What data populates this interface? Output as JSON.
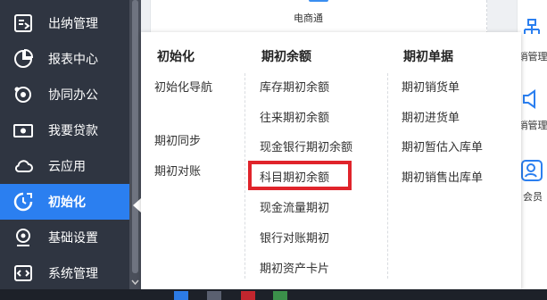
{
  "sidebar": {
    "items": [
      {
        "label": "出纳管理",
        "icon": "cashier-icon"
      },
      {
        "label": "报表中心",
        "icon": "pie-chart-icon"
      },
      {
        "label": "协同办公",
        "icon": "collab-icon"
      },
      {
        "label": "我要贷款",
        "icon": "money-icon"
      },
      {
        "label": "云应用",
        "icon": "cloud-icon"
      },
      {
        "label": "初始化",
        "icon": "init-icon",
        "active": true
      },
      {
        "label": "基础设置",
        "icon": "settings-icon"
      },
      {
        "label": "系统管理",
        "icon": "code-icon"
      }
    ]
  },
  "top": {
    "card_label": "电商通"
  },
  "right_strip": {
    "items": [
      "销管理",
      "销管理",
      "会员"
    ]
  },
  "popup": {
    "columns": [
      {
        "title": "初始化",
        "items": [
          "初始化导航",
          "期初同步",
          "期初对账"
        ]
      },
      {
        "title": "期初余额",
        "items": [
          "库存期初余额",
          "往来期初余额",
          "现金银行期初余额",
          "科目期初余额",
          "现金流量期初",
          "银行对账期初",
          "期初资产卡片"
        ]
      },
      {
        "title": "期初单据",
        "items": [
          "期初销货单",
          "期初进货单",
          "期初暂估入库单",
          "期初销售出库单"
        ]
      }
    ],
    "highlighted": "科目期初余额"
  },
  "colors": {
    "sidebar_bg": "#2f3541",
    "active": "#2b7ff0",
    "highlight": "#e0242b"
  }
}
